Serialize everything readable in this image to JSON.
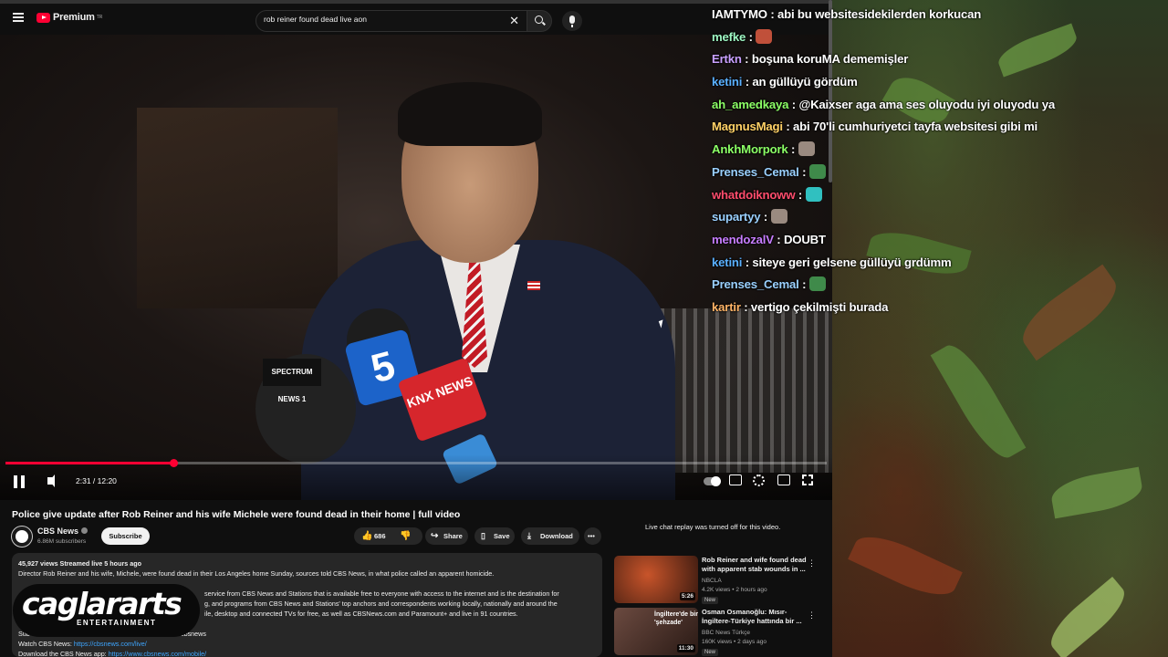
{
  "header": {
    "logo_text": "Premium",
    "logo_sup": "TR",
    "search_value": "rob reiner found dead live aon"
  },
  "player": {
    "time": "2:31 / 12:20",
    "progress": 0.204,
    "mic_cubes": {
      "spectrum": "SPECTRUM NEWS 1",
      "klax": "5",
      "knx": "KNX NEWS"
    }
  },
  "chat": [
    {
      "user": "IAMTYMO",
      "color": "#ffffff",
      "text": "abi bu websitesidekilerden korkucan"
    },
    {
      "user": "mefke",
      "color": "#9ef7c3",
      "text": "",
      "emote": "#c0503a"
    },
    {
      "user": "Ertkn",
      "color": "#c9a0ff",
      "text": "boşuna koruMA dememişler"
    },
    {
      "user": "ketini",
      "color": "#5ab0ff",
      "text": "an güllüyü gördüm"
    },
    {
      "user": "ah_amedkaya",
      "color": "#8cff66",
      "text": "@Kaixser aga ama ses oluyodu iyi oluyodu ya"
    },
    {
      "user": "MagnusMagi",
      "color": "#ffd166",
      "text": "abi 70'li cumhuriyetci tayfa websitesi gibi mi"
    },
    {
      "user": "AnkhMorpork",
      "color": "#8cff66",
      "text": "",
      "emote": "#9a8a80"
    },
    {
      "user": "Prenses_Cemal",
      "color": "#9ad0ff",
      "text": "",
      "emote": "#3f8a4a"
    },
    {
      "user": "whatdoiknoww",
      "color": "#ff4d6d",
      "text": "",
      "emote": "#30c0c0"
    },
    {
      "user": "supartyy",
      "color": "#9ad0ff",
      "text": "",
      "emote": "#9a8a80"
    },
    {
      "user": "mendozalV",
      "color": "#c77dff",
      "text": "DOUBT"
    },
    {
      "user": "ketini",
      "color": "#5ab0ff",
      "text": "siteye geri gelsene güllüyü grdümm"
    },
    {
      "user": "Prenses_Cemal",
      "color": "#9ad0ff",
      "text": "",
      "emote": "#3f8a4a"
    },
    {
      "user": "kartir",
      "color": "#ffb366",
      "text": "vertigo çekilmişti burada"
    }
  ],
  "video": {
    "title": "Police give update after Rob Reiner and his wife Michele were found dead in their home | full video",
    "channel": "CBS News",
    "subscribers": "6.86M subscribers",
    "subscribe_label": "Subscribe",
    "likes": "686",
    "share_label": "Share",
    "save_label": "Save",
    "download_label": "Download",
    "views_line": "45,927 views  Streamed live 5 hours ago",
    "description_1": "Director Rob Reiner and his wife, Michele, were found dead in their Los Angeles home Sunday, sources told CBS News, in what police called an apparent homicide.",
    "description_2": "service from CBS News and Stations that is available free to everyone with access to the internet and is the destination for",
    "description_3": "g, and programs from CBS News and Stations' top anchors and correspondents working locally, nationally and around the",
    "description_4": "ile, desktop and connected TVs for free, as well as CBSNews.com and Paramount+ and live in 91 countries.",
    "description_5_prefix": "Sub",
    "description_5_suffix": "sbsnews",
    "watch_label": "Watch CBS News:",
    "watch_link": "https://cbsnews.com/live/",
    "app_label": "Download the CBS News app:",
    "app_link": "https://www.cbsnews.com/mobile/"
  },
  "watermark": {
    "name": "caglararts",
    "sub": "ENTERTAINMENT"
  },
  "sidebar": {
    "chat_notice": "Live chat replay was turned off for this video.",
    "recs": [
      {
        "title": "Rob Reiner and wife found dead with apparent stab wounds in ...",
        "channel": "NBCLA",
        "meta": "4.2K views • 2 hours ago",
        "badge": "New",
        "duration": "5:26",
        "thumb": "#7a2a18"
      },
      {
        "title": "Osman Osmanoğlu: Mısır-İngiltere-Türkiye hattında bir ...",
        "channel": "BBC News Türkçe",
        "meta": "160K views • 2 days ago",
        "badge": "New",
        "duration": "11:30",
        "thumb": "#5a3a30",
        "thumb_text": "İngiltere'de bir 'şehzade'"
      }
    ]
  }
}
